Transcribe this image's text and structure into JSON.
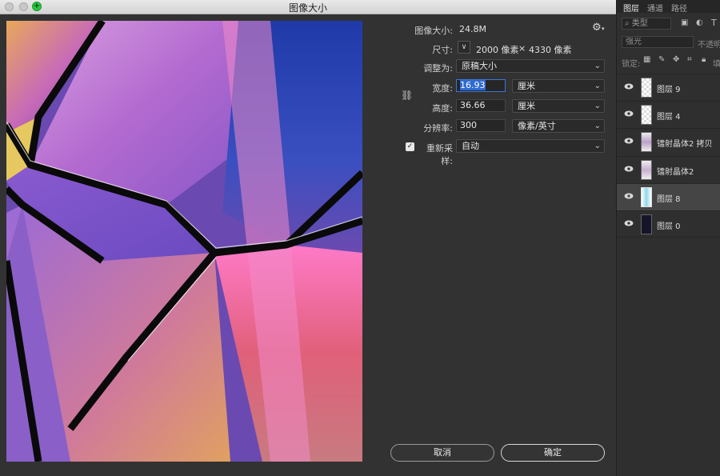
{
  "window": {
    "title": "图像大小"
  },
  "image_size": {
    "label": "图像大小:",
    "value": "24.8M"
  },
  "dimensions": {
    "label": "尺寸:",
    "width": "2000 像素",
    "times": "×",
    "height": "4330 像素"
  },
  "fit_to": {
    "label": "调整为:",
    "value": "原稿大小"
  },
  "width": {
    "label": "宽度:",
    "value": "16.93",
    "unit": "厘米"
  },
  "height": {
    "label": "高度:",
    "value": "36.66",
    "unit": "厘米"
  },
  "resolution": {
    "label": "分辨率:",
    "value": "300",
    "unit": "像素/英寸"
  },
  "resample": {
    "label": "重新采样:",
    "checked": true,
    "value": "自动"
  },
  "buttons": {
    "cancel": "取消",
    "ok": "确定"
  },
  "panel": {
    "tabs": [
      "图层",
      "通道",
      "路径"
    ],
    "search_placeholder": "类型",
    "blend_mode": "强光",
    "opacity_label": "不透明",
    "lock_label": "锁定:",
    "fill_label": "填",
    "layers": [
      {
        "name": "图层 9",
        "selected": false
      },
      {
        "name": "图层 4",
        "selected": false
      },
      {
        "name": "镭射晶体2 拷贝",
        "selected": false
      },
      {
        "name": "镭射晶体2",
        "selected": false
      },
      {
        "name": "图层 8",
        "selected": true
      },
      {
        "name": "图层 0",
        "selected": false
      }
    ]
  },
  "colors": {
    "accent": "#3b76d8",
    "dialog_bg": "#323232",
    "panel_bg": "#2f2f2f"
  }
}
